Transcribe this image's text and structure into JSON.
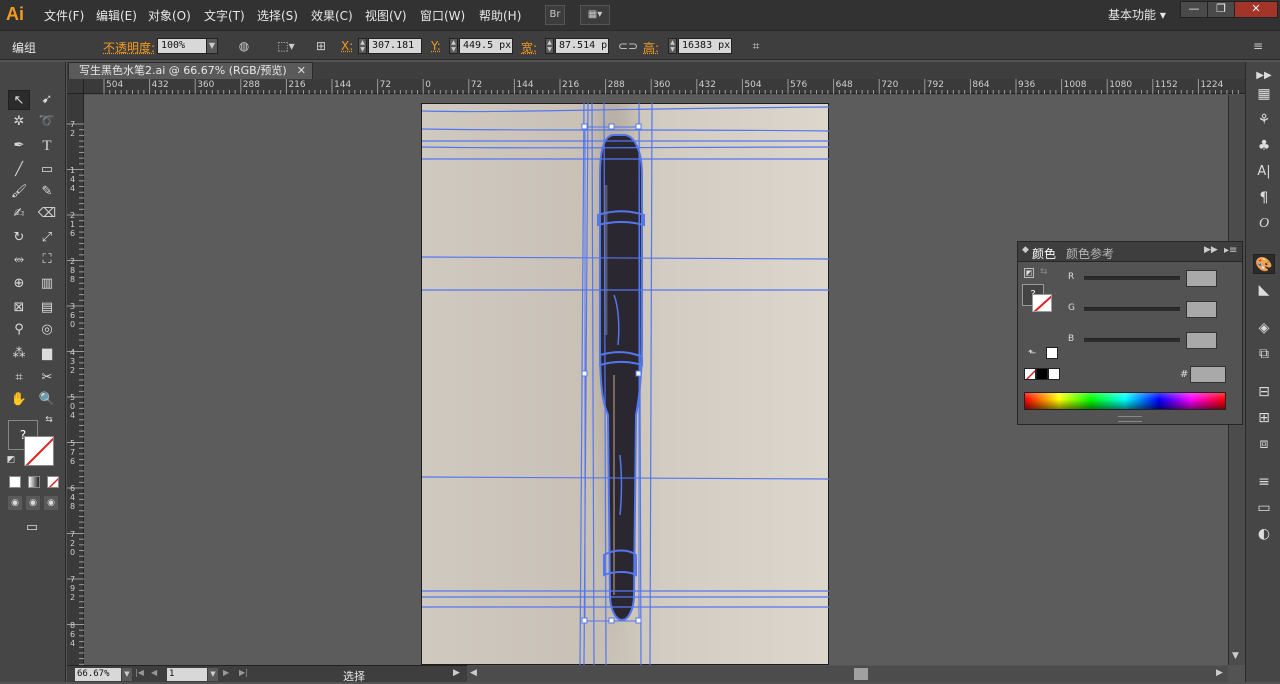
{
  "app": {
    "logo": "Ai",
    "menu": [
      "文件(F)",
      "编辑(E)",
      "对象(O)",
      "文字(T)",
      "选择(S)",
      "效果(C)",
      "视图(V)",
      "窗口(W)",
      "帮助(H)"
    ],
    "bridge_button": "Br",
    "workspace": "基本功能",
    "window_buttons": [
      "—",
      "❐",
      "✕"
    ]
  },
  "control_bar": {
    "mode_label": "编组",
    "opacity_label": "不透明度:",
    "opacity_value": "100%",
    "x_label": "X:",
    "x_value": "307.181",
    "y_label": "Y:",
    "y_value": "449.5 px",
    "w_label": "宽:",
    "w_value": "87.514 p",
    "h_label": "高:",
    "h_value": "16383 px"
  },
  "document": {
    "tab_title": "写生黑色水笔2.ai @ 66.67% (RGB/预览)",
    "close": "✕"
  },
  "ruler_h": [
    "504",
    "432",
    "360",
    "288",
    "216",
    "144",
    "72",
    "0",
    "72",
    "144",
    "216",
    "288",
    "360",
    "432",
    "504",
    "576",
    "648",
    "720",
    "792",
    "864",
    "936",
    "1008",
    "1080",
    "1152",
    "1224"
  ],
  "ruler_v": [
    "7\n2",
    "1\n4\n4",
    "2\n1\n6",
    "2\n8\n8",
    "3\n6\n0",
    "4\n3\n2",
    "5\n0\n4",
    "5\n7\n6",
    "6\n4\n8",
    "7\n2\n0",
    "7\n9\n2",
    "8\n6\n4"
  ],
  "status": {
    "zoom": "66.67%",
    "page": "1",
    "tool": "选择"
  },
  "color_panel": {
    "tab_active": "颜色",
    "tab_inactive": "颜色参考",
    "channels": [
      "R",
      "G",
      "B"
    ],
    "hex_label": "#",
    "question": "?"
  },
  "toolbox": {
    "question": "?"
  }
}
